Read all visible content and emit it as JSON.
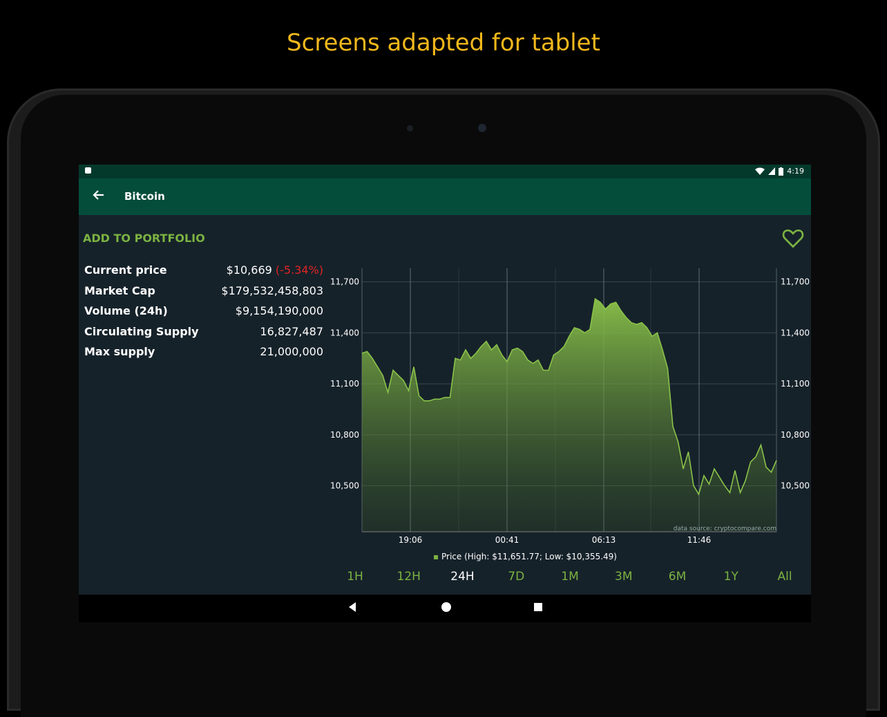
{
  "promo": {
    "headline": "Screens adapted for tablet"
  },
  "status_bar": {
    "time": "4:19"
  },
  "app_bar": {
    "title": "Bitcoin"
  },
  "actions": {
    "add_to_portfolio": "ADD TO PORTFOLIO",
    "favorite_icon": "heart-outline-icon"
  },
  "stats": [
    {
      "label": "Current price",
      "value": "$10,669",
      "change": "(-5.34%)"
    },
    {
      "label": "Market Cap",
      "value": "$179,532,458,803"
    },
    {
      "label": "Volume (24h)",
      "value": "$9,154,190,000"
    },
    {
      "label": "Circulating Supply",
      "value": "16,827,487"
    },
    {
      "label": "Max supply",
      "value": "21,000,000"
    }
  ],
  "colors": {
    "accent": "#7cb342",
    "negative": "#e02424",
    "appbar": "#044d3b",
    "statusbar": "#03392b",
    "screen_bg": "#16222a",
    "promo": "#f2b81c"
  },
  "chart_data": {
    "type": "area",
    "x_ticks": [
      "19:06",
      "00:41",
      "06:13",
      "11:46"
    ],
    "y_ticks": [
      "11,700",
      "11,400",
      "11,100",
      "10,800",
      "10,500"
    ],
    "ylim": [
      10230,
      11780
    ],
    "legend": "Price (High: $11,651.77; Low: $10,355.49)",
    "source": "data source: cryptocompare.com",
    "grid": true,
    "legend_position": "bottom",
    "series": [
      {
        "values": [
          11280,
          11290,
          11250,
          11200,
          11150,
          11050,
          11180,
          11150,
          11120,
          11060,
          11200,
          11030,
          11000,
          11000,
          11010,
          11010,
          11020,
          11020,
          11250,
          11240,
          11300,
          11250,
          11280,
          11320,
          11350,
          11300,
          11330,
          11270,
          11230,
          11300,
          11310,
          11290,
          11240,
          11220,
          11240,
          11180,
          11180,
          11270,
          11290,
          11320,
          11380,
          11430,
          11420,
          11400,
          11420,
          11600,
          11580,
          11540,
          11570,
          11580,
          11530,
          11490,
          11460,
          11450,
          11460,
          11430,
          11380,
          11400,
          11300,
          11190,
          10850,
          10760,
          10600,
          10700,
          10500,
          10450,
          10560,
          10510,
          10600,
          10550,
          10500,
          10460,
          10590,
          10460,
          10530,
          10640,
          10670,
          10740,
          10610,
          10580,
          10650
        ]
      }
    ]
  },
  "periods": [
    "1H",
    "12H",
    "24H",
    "7D",
    "1M",
    "3M",
    "6M",
    "1Y",
    "All"
  ],
  "active_period": "24H",
  "nav": {
    "back_icon": "nav-back-icon",
    "home_icon": "nav-home-icon",
    "recents_icon": "nav-recents-icon"
  }
}
